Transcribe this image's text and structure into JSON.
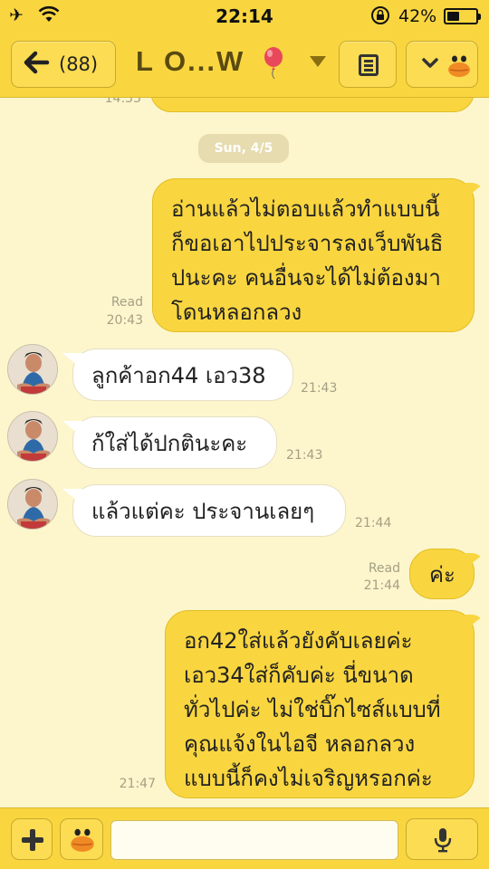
{
  "status_bar": {
    "time": "22:14",
    "battery_text": "42%",
    "battery_level": 0.42,
    "icons": [
      "airplane-icon",
      "wifi-icon",
      "rotation-lock-icon",
      "battery-icon"
    ]
  },
  "header": {
    "back_arrow": "🡐",
    "back_count": "(88)",
    "title": "L O...W",
    "title_icon": "balloon-icon",
    "menu_icon": "menu-icon",
    "sticker_icon": "sticker-face-icon"
  },
  "chat": {
    "date_label": "Sun, 4/5",
    "top_partial_time": "14:35",
    "messages": [
      {
        "side": "me",
        "text": "อ่านแล้วไม่ตอบแล้วทำแบบนี้\nก็ขอเอาไปประจารลงเว็บพันธิ\nปนะคะ คนอื่นจะได้ไม่ต้องมา\nโดนหลอกลวง",
        "read": "Read",
        "time": "20:43"
      },
      {
        "side": "them",
        "text": "ลูกค้าอก44 เอว38",
        "time": "21:43"
      },
      {
        "side": "them",
        "text": "ก้ใส่ได้ปกตินะคะ",
        "time": "21:43"
      },
      {
        "side": "them",
        "text": "แล้วแต่คะ ประจานเลยๆ",
        "time": "21:44"
      },
      {
        "side": "me",
        "text": "ค่ะ",
        "read": "Read",
        "time": "21:44"
      },
      {
        "side": "me",
        "text": "อก42ใส่แล้วยังคับเลยค่ะ\nเอว34ใส่ก็คับค่ะ นี่ขนาด\nทั่วไปค่ะ ไม่ใช่บิ๊กไซส์แบบที่\nคุณแจ้งในไอจี หลอกลวง\nแบบนี้ก็คงไม่เจริญหรอกค่ะ",
        "time": "21:47"
      }
    ]
  },
  "input_bar": {
    "placeholder": "",
    "value": ""
  },
  "colors": {
    "bar": "#f9d640",
    "my_bubble": "#f9d640",
    "their_bubble": "#ffffff",
    "chat_bg": "#fdf6cc"
  }
}
